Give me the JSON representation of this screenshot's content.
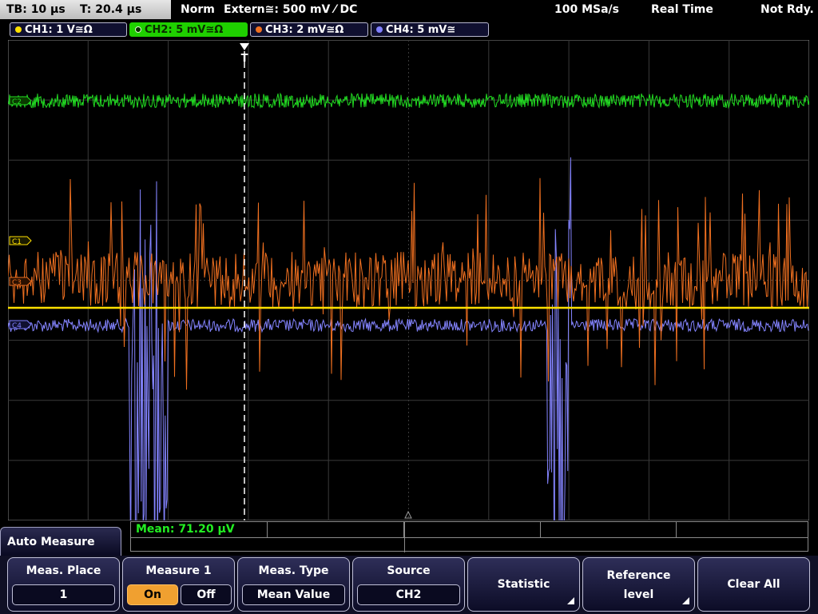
{
  "topbar": {
    "timebase": "TB: 10 µs",
    "trigger_time": "T: 20.4 µs",
    "mode": "Norm",
    "trigger_source": "Extern≅: 500 mV ⁄ DC",
    "sample_rate": "100 MSa/s",
    "acq_mode": "Real Time",
    "status": "Not Rdy."
  },
  "channels": [
    {
      "label": "CH1: 1 V≅Ω",
      "color": "#ffe000"
    },
    {
      "label": "CH2: 5 mV≅Ω",
      "color": "#1fd000"
    },
    {
      "label": "CH3: 2 mV≅Ω",
      "color": "#f07020"
    },
    {
      "label": "CH4: 5 mV≅",
      "color": "#8080ff"
    }
  ],
  "plot": {
    "markers": {
      "c1": "C1",
      "c2": "C2",
      "c3": "C3",
      "c4": "C4"
    },
    "trigger_marker": "T"
  },
  "measurement": {
    "mean": "Mean: 71.20 µV"
  },
  "menu": {
    "title": "Auto Measure",
    "softkeys": {
      "meas_place": {
        "label": "Meas. Place",
        "value": "1"
      },
      "measure1": {
        "label": "Measure 1",
        "on": "On",
        "off": "Off"
      },
      "meas_type": {
        "label": "Meas. Type",
        "value": "Mean Value"
      },
      "source": {
        "label": "Source",
        "value": "CH2"
      },
      "statistic": {
        "label": "Statistic"
      },
      "reference": {
        "label1": "Reference",
        "label2": "level"
      },
      "clear_all": {
        "label": "Clear All"
      }
    }
  }
}
